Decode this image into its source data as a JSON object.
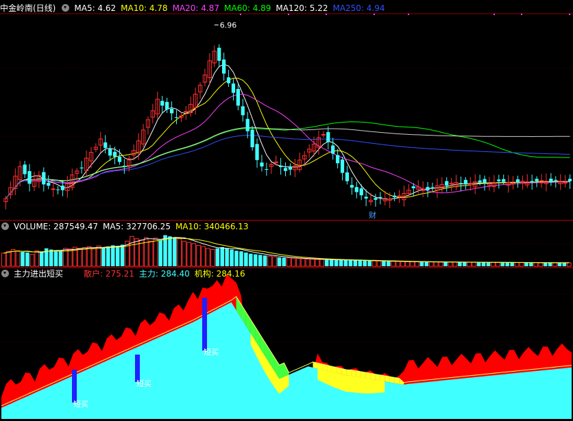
{
  "main": {
    "title": "中金岭南(日线)",
    "ma": [
      {
        "label": "MA5: 4.62",
        "color": "#ffffff"
      },
      {
        "label": "MA10: 4.78",
        "color": "#ffff00"
      },
      {
        "label": "MA20: 4.87",
        "color": "#ff40ff"
      },
      {
        "label": "MA60: 4.89",
        "color": "#00ff00"
      },
      {
        "label": "MA120: 5.22",
        "color": "#ffffff"
      },
      {
        "label": "MA250: 4.94",
        "color": "#3050ff"
      }
    ],
    "high_label": "6.96",
    "event_label": "财"
  },
  "volume": {
    "label": "VOLUME: 287549.47",
    "ma5": "MA5: 327706.25",
    "ma10": "MA10: 340466.13"
  },
  "indicator": {
    "title": "主力进出短买",
    "retail": "散户: 275.21",
    "main": "主力: 284.40",
    "inst": "机构: 284.16",
    "signal_label": "短买"
  },
  "colors": {
    "up": "#ff3030",
    "down": "#40ffff",
    "grid": "#8b0000",
    "retail": "#ff0000",
    "main": "#40ffff",
    "inst": "#ffff00",
    "signal": "#2020ff"
  },
  "chart_data": [
    {
      "type": "candlestick",
      "title": "中金岭南(日线)",
      "price_range": [
        3.95,
        7.05
      ],
      "high_mark": 6.96,
      "close": [
        4.25,
        4.42,
        4.6,
        4.75,
        4.63,
        4.48,
        4.55,
        4.61,
        4.47,
        4.45,
        4.4,
        4.39,
        4.38,
        4.48,
        4.62,
        4.68,
        4.72,
        4.88,
        4.97,
        5.05,
        5.18,
        5.04,
        4.92,
        4.9,
        4.82,
        4.75,
        4.87,
        5.0,
        5.15,
        5.32,
        5.48,
        5.62,
        5.8,
        5.7,
        5.64,
        5.58,
        5.51,
        5.54,
        5.61,
        5.72,
        5.88,
        6.02,
        6.18,
        6.4,
        6.55,
        6.4,
        6.2,
        6.05,
        5.9,
        5.7,
        5.55,
        5.3,
        5.05,
        4.85,
        4.75,
        4.7,
        4.78,
        4.82,
        4.74,
        4.68,
        4.7,
        4.76,
        4.85,
        4.92,
        5.02,
        5.1,
        5.2,
        5.25,
        5.13,
        4.95,
        4.8,
        4.65,
        4.52,
        4.42,
        4.35,
        4.3,
        4.25,
        4.22,
        4.23,
        4.26,
        4.25,
        4.24,
        4.27,
        4.29,
        4.33,
        4.38,
        4.41,
        4.43,
        4.4,
        4.38,
        4.42,
        4.45,
        4.47,
        4.45,
        4.49,
        4.5,
        4.48,
        4.47,
        4.49,
        4.51,
        4.5,
        4.49,
        4.48,
        4.5,
        4.52,
        4.51,
        4.5,
        4.49,
        4.5,
        4.52,
        4.51,
        4.5,
        4.52,
        4.53,
        4.52,
        4.5,
        4.53,
        4.52,
        4.5,
        4.52
      ],
      "ma_last": {
        "MA5": 4.62,
        "MA10": 4.78,
        "MA20": 4.87,
        "MA60": 4.89,
        "MA120": 5.22,
        "MA250": 4.94
      },
      "annotations": [
        "6.96",
        "财"
      ]
    },
    {
      "type": "bar",
      "title": "VOLUME",
      "values": [
        220,
        250,
        280,
        260,
        240,
        230,
        200,
        260,
        240,
        300,
        280,
        250,
        260,
        300,
        290,
        320,
        300,
        310,
        330,
        300,
        340,
        310,
        330,
        350,
        340,
        360,
        420,
        500,
        460,
        440,
        480,
        420,
        470,
        440,
        520,
        500,
        480,
        460,
        420,
        400,
        380,
        350,
        330,
        300,
        280,
        300,
        320,
        300,
        280,
        260,
        250,
        230,
        210,
        200,
        190,
        180,
        170,
        160,
        150,
        145,
        140,
        135,
        130,
        125,
        120,
        118,
        115,
        112,
        110,
        108,
        106,
        104,
        102,
        100,
        98,
        96,
        94,
        92,
        90,
        88,
        86,
        84,
        82,
        80,
        78,
        78,
        76,
        75,
        74,
        73,
        72,
        72,
        71,
        70,
        70,
        69,
        68,
        68,
        67,
        67,
        66,
        66,
        65,
        65,
        64,
        64,
        63,
        63,
        62,
        62,
        61,
        61,
        60,
        60,
        60,
        59,
        59,
        58,
        58,
        58
      ],
      "current": 287549.47,
      "ma5": 327706.25,
      "ma10": 340466.13
    },
    {
      "type": "area",
      "title": "主力进出短买",
      "series": [
        {
          "name": "散户",
          "last": 275.21
        },
        {
          "name": "主力",
          "last": 284.4
        },
        {
          "name": "机构",
          "last": 284.16
        }
      ],
      "signals": [
        "短买",
        "短买",
        "短买"
      ]
    }
  ]
}
